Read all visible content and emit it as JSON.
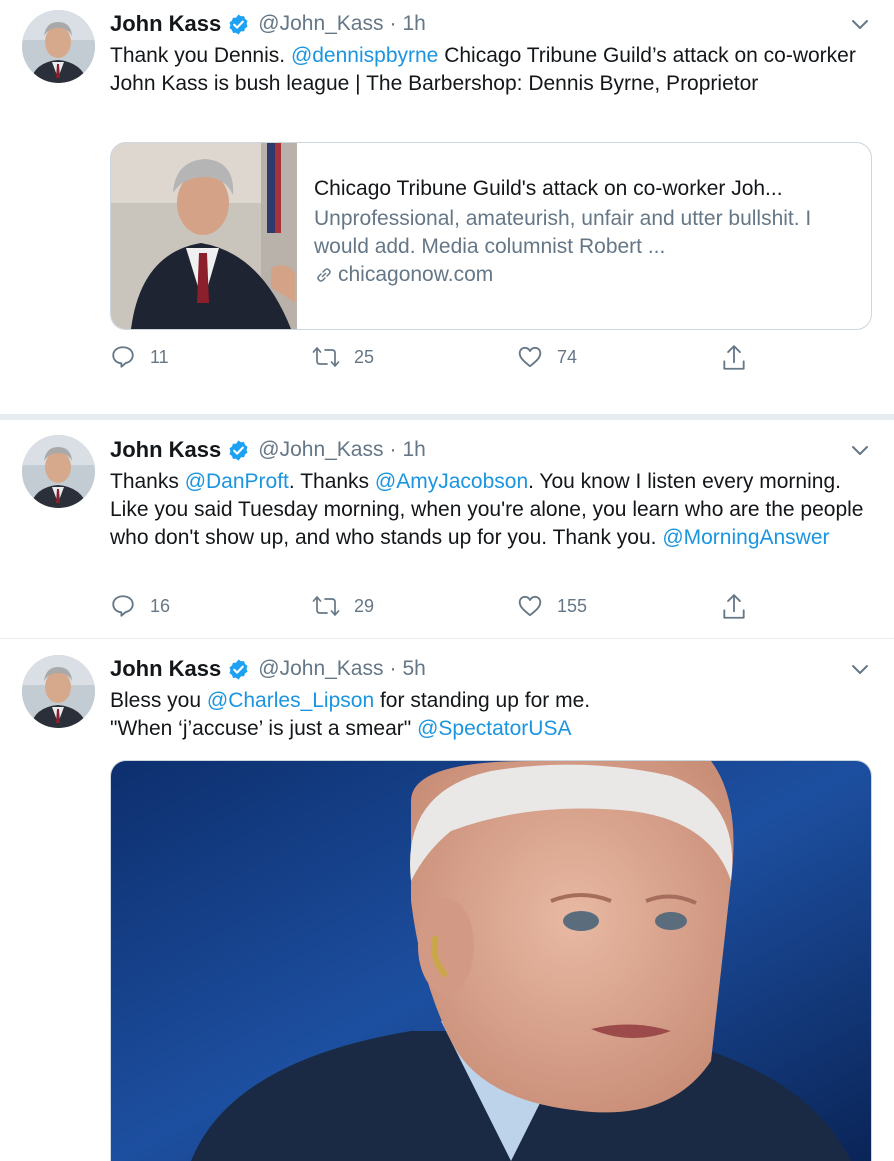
{
  "tweets": [
    {
      "name": "John Kass",
      "handle": "@John_Kass",
      "dot": "·",
      "time": "1h",
      "text": [
        {
          "t": "Thank you Dennis. ",
          "m": false
        },
        {
          "t": "@dennispbyrne",
          "m": true
        },
        {
          "t": "  Chicago Tribune Guild’s attack on co-worker John Kass is bush league | The Barbershop: Dennis Byrne, Proprietor",
          "m": false
        }
      ],
      "card": {
        "title": "Chicago Tribune Guild's attack on co-worker Joh...",
        "description": "Unprofessional, amateurish, unfair and utter bullshit. I would add. Media columnist Robert ...",
        "domain": "chicagonow.com"
      },
      "replies": "11",
      "retweets": "25",
      "likes": "74"
    },
    {
      "name": "John Kass",
      "handle": "@John_Kass",
      "dot": "·",
      "time": "1h",
      "text": [
        {
          "t": "Thanks ",
          "m": false
        },
        {
          "t": "@DanProft",
          "m": true
        },
        {
          "t": ". Thanks ",
          "m": false
        },
        {
          "t": "@AmyJacobson",
          "m": true
        },
        {
          "t": ". You know I listen every morning.  Like you said Tuesday morning, when you're alone, you learn who are the people who don't show up, and who stands up for you. Thank you. ",
          "m": false
        },
        {
          "t": "@MorningAnswer",
          "m": true
        }
      ],
      "replies": "16",
      "retweets": "29",
      "likes": "155"
    },
    {
      "name": "John Kass",
      "handle": "@John_Kass",
      "dot": "·",
      "time": "5h",
      "text": [
        {
          "t": "Bless you ",
          "m": false
        },
        {
          "t": "@Charles_Lipson",
          "m": true
        },
        {
          "t": " for standing up for me.",
          "m": false
        },
        {
          "t": "\n",
          "m": false
        },
        {
          "t": "\"When ‘j’accuse’ is just a smear\" ",
          "m": false
        },
        {
          "t": "@SpectatorUSA",
          "m": true
        }
      ]
    }
  ],
  "icons": {
    "verified": "verified-badge-icon",
    "menu": "chevron-down-icon",
    "reply": "reply-icon",
    "retweet": "retweet-icon",
    "like": "heart-icon",
    "share": "share-icon",
    "link": "link-icon"
  },
  "colors": {
    "accent": "#1b95e0",
    "secondary_text": "#657786",
    "divider": "#e6ecf0"
  }
}
